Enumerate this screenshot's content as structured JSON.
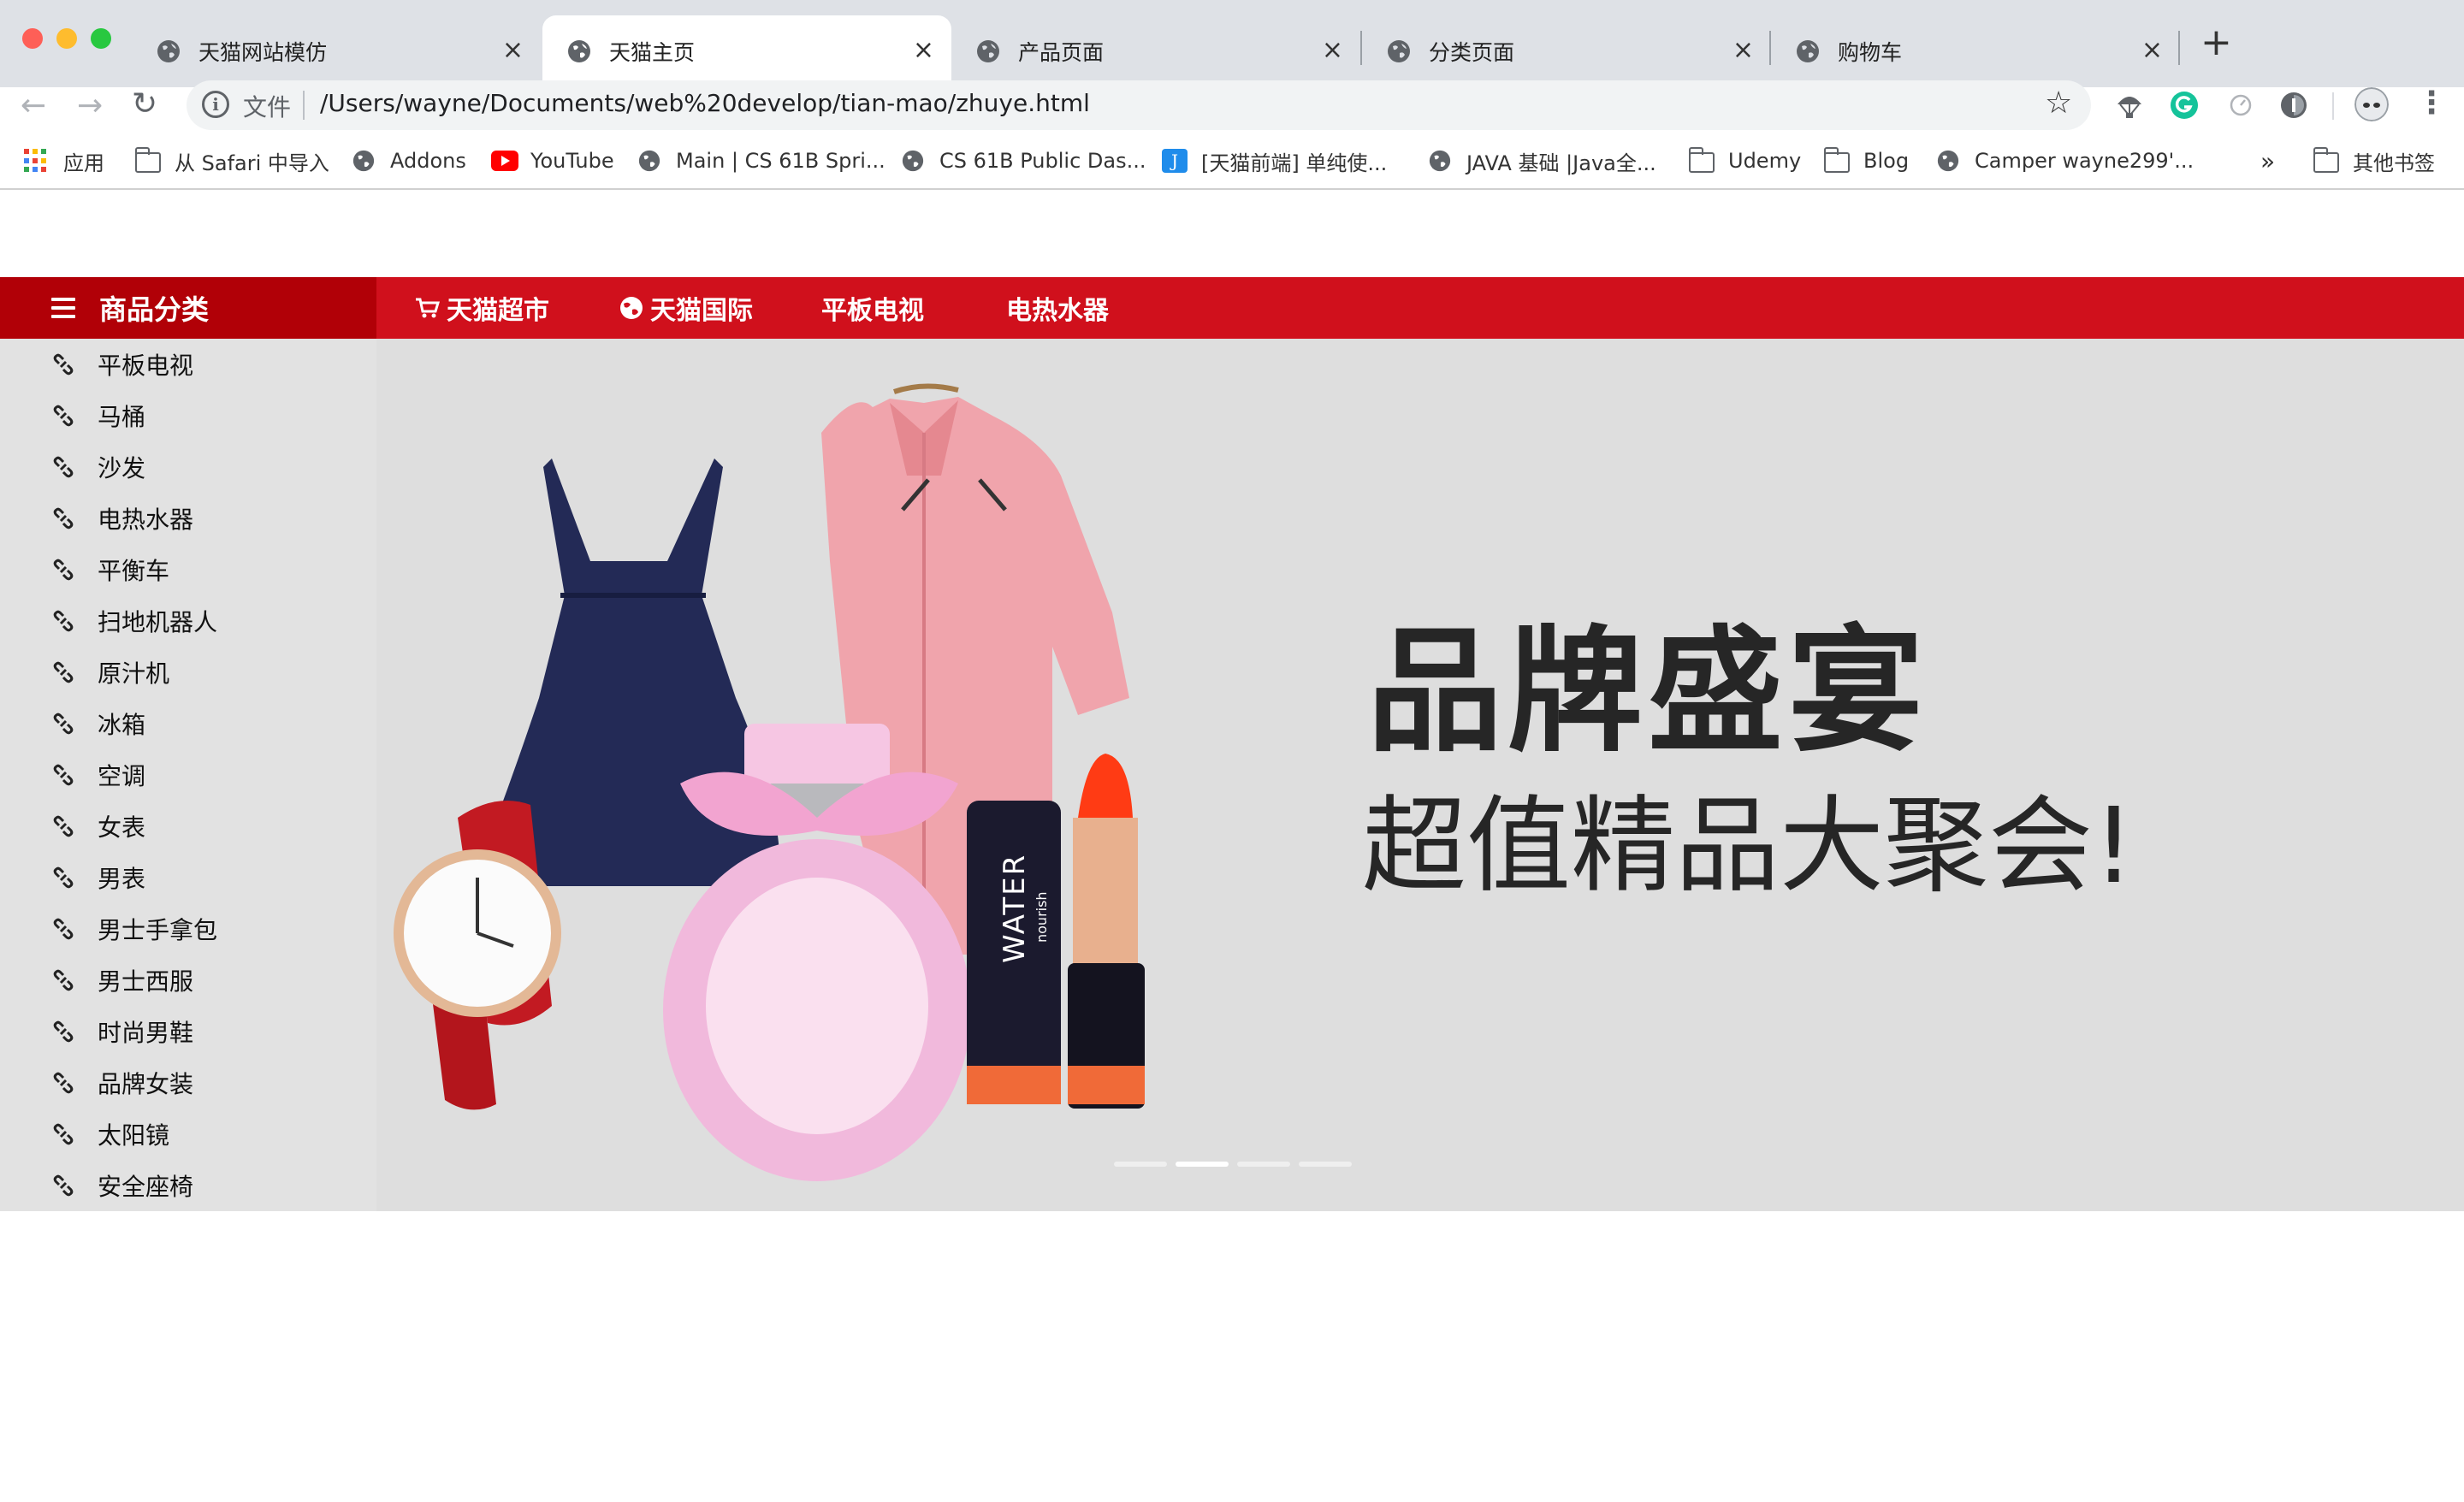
{
  "browser": {
    "tabs": [
      {
        "title": "天猫网站模仿",
        "close": "×",
        "active": false
      },
      {
        "title": "天猫主页",
        "close": "×",
        "active": true
      },
      {
        "title": "产品页面",
        "close": "×",
        "active": false
      },
      {
        "title": "分类页面",
        "close": "×",
        "active": false
      },
      {
        "title": "购物车",
        "close": "×",
        "active": false
      }
    ],
    "new_tab": "+",
    "nav": {
      "back": "←",
      "forward": "→",
      "reload": "↻"
    },
    "omnibox": {
      "info": "i",
      "scheme_label": "文件",
      "url": "/Users/wayne/Documents/web%20develop/tian-mao/zhuye.html",
      "star": "☆"
    },
    "menu": "⋮",
    "bookmarks": [
      {
        "label": "应用",
        "icon": "apps-grid-icon"
      },
      {
        "label": "从 Safari 中导入",
        "icon": "folder-icon"
      },
      {
        "label": "Addons",
        "icon": "globe-icon"
      },
      {
        "label": "YouTube",
        "icon": "youtube-icon"
      },
      {
        "label": "Main | CS 61B Spri...",
        "icon": "globe-icon"
      },
      {
        "label": "CS 61B Public Das...",
        "icon": "globe-icon"
      },
      {
        "label": "[天猫前端] 单纯使...",
        "icon": "j-icon"
      },
      {
        "label": "JAVA 基础 |Java全...",
        "icon": "globe-icon"
      },
      {
        "label": "Udemy",
        "icon": "folder-icon"
      },
      {
        "label": "Blog",
        "icon": "folder-icon"
      },
      {
        "label": "Camper wayne299'...",
        "icon": "globe-icon"
      }
    ],
    "bookmarks_more": "»",
    "other_bookmarks": "其他书签"
  },
  "page": {
    "category_header": "商品分类",
    "top_nav": [
      {
        "label": "天猫超市",
        "icon": "cart-icon"
      },
      {
        "label": "天猫国际",
        "icon": "globe-icon"
      },
      {
        "label": "平板电视",
        "icon": ""
      },
      {
        "label": "电热水器",
        "icon": ""
      }
    ],
    "categories": [
      "平板电视",
      "马桶",
      "沙发",
      "电热水器",
      "平衡车",
      "扫地机器人",
      "原汁机",
      "冰箱",
      "空调",
      "女表",
      "男表",
      "男士手拿包",
      "男士西服",
      "时尚男鞋",
      "品牌女装",
      "太阳镜",
      "安全座椅"
    ],
    "banner": {
      "headline": "品牌盛宴",
      "subheadline": "超值精品大聚会!",
      "product_label": "WATER",
      "product_sublabel": "nourish",
      "carousel_count": 4,
      "carousel_active": 1
    }
  },
  "colors": {
    "brand_red": "#d0101c",
    "brand_dark_red": "#b10007",
    "sidebar_bg": "#e2e2e2",
    "banner_bg": "#dedede",
    "headline": "#262626"
  }
}
